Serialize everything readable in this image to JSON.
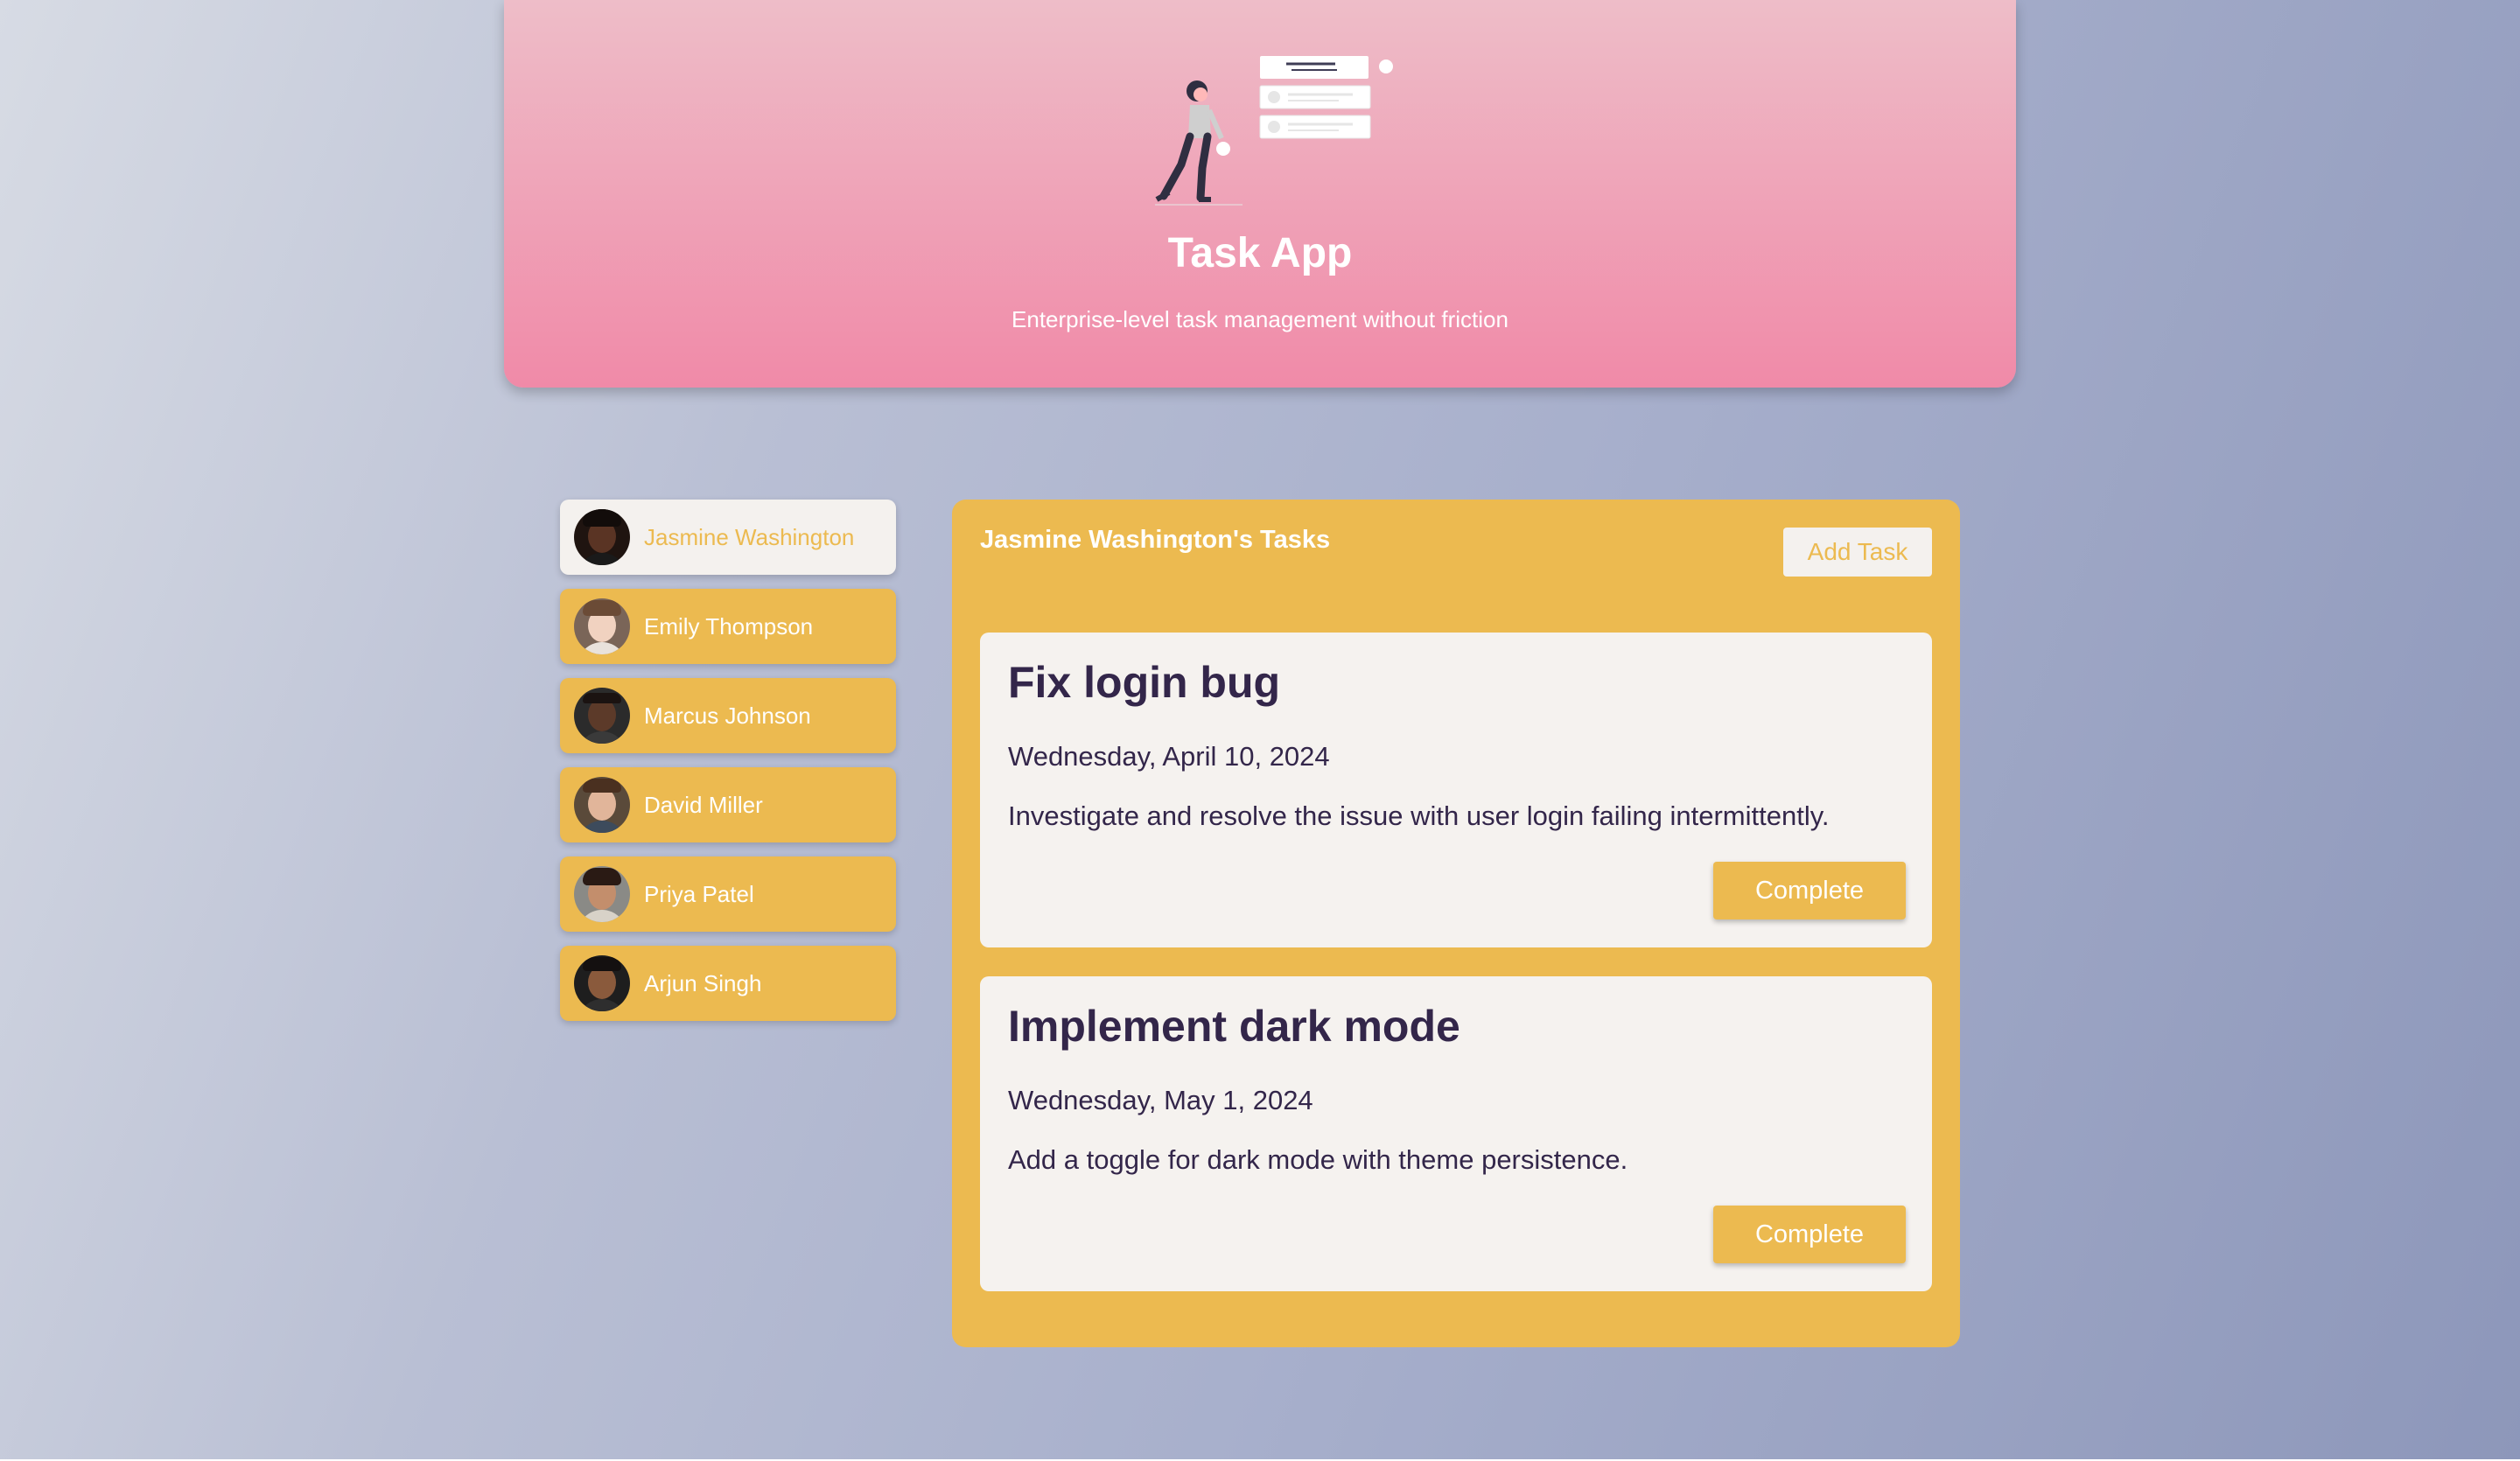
{
  "app": {
    "title": "Task App",
    "subtitle": "Enterprise-level task management without friction"
  },
  "users": [
    {
      "name": "Jasmine Washington",
      "active": true,
      "avatar_icon": "avatar-jasmine"
    },
    {
      "name": "Emily Thompson",
      "active": false,
      "avatar_icon": "avatar-emily"
    },
    {
      "name": "Marcus Johnson",
      "active": false,
      "avatar_icon": "avatar-marcus"
    },
    {
      "name": "David Miller",
      "active": false,
      "avatar_icon": "avatar-david"
    },
    {
      "name": "Priya Patel",
      "active": false,
      "avatar_icon": "avatar-priya"
    },
    {
      "name": "Arjun Singh",
      "active": false,
      "avatar_icon": "avatar-arjun"
    }
  ],
  "panel": {
    "title": "Jasmine Washington's Tasks",
    "add_task_label": "Add Task"
  },
  "tasks": [
    {
      "title": "Fix login bug",
      "date": "Wednesday, April 10, 2024",
      "description": "Investigate and resolve the issue with user login failing intermittently.",
      "complete_label": "Complete"
    },
    {
      "title": "Implement dark mode",
      "date": "Wednesday, May 1, 2024",
      "description": "Add a toggle for dark mode with theme persistence.",
      "complete_label": "Complete"
    }
  ],
  "colors": {
    "accent": "#ecba50",
    "header_top": "#eebdc8",
    "header_bottom": "#f08aa8",
    "card_bg": "#f5f2ef",
    "text_dark": "#33264a"
  }
}
